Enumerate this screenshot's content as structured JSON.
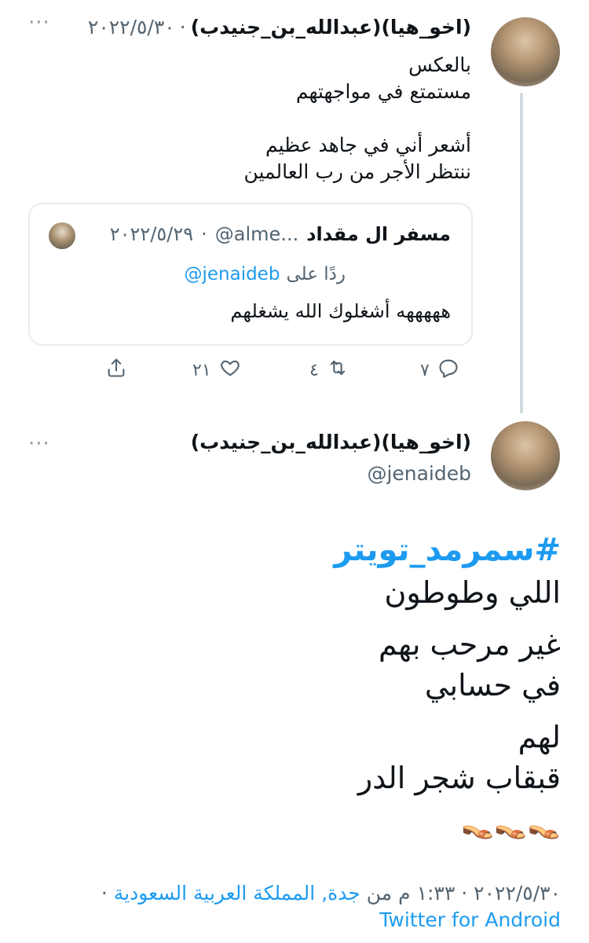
{
  "reply_tweet": {
    "display_name": "(اخو_هيا)(عبدالله_بن_جنيدب)",
    "date": "٢٠٢٢/٥/٣٠",
    "separator": "·",
    "text_lines": [
      "بالعكس",
      "مستمتع في مواجهتهم",
      "",
      "أشعر أني في جاهد عظيم",
      "ننتظر الأجر من رب العالمين"
    ],
    "more_icon": "more-horizontal-icon",
    "quote": {
      "display_name": "مسفر ال مقداد",
      "handle": "@alme...",
      "date": "٢٠٢٢/٥/٢٩",
      "separator": "·",
      "replying_to_label": "ردًا على",
      "replying_to_handle": "@jenaideb",
      "text": "هههههه أشغلوك الله يشغلهم"
    },
    "actions": {
      "reply_count": "٧",
      "retweet_count": "٤",
      "like_count": "٢١"
    }
  },
  "main_tweet": {
    "display_name": "(اخو_هيا)(عبدالله_بن_جنيدب)",
    "handle": "@jenaideb",
    "hashtag": "#سمرمد_تويتر",
    "paragraphs": [
      [
        "اللي وطوطون"
      ],
      [
        "غير مرحب بهم",
        "في حسابي"
      ],
      [
        "لهم",
        "قبقاب شجر الدر"
      ]
    ],
    "emoji": "👡👡👡",
    "time": "١:٣٣ م",
    "date": "٢٠٢٢/٥/٣٠",
    "separator": "·",
    "from_label": "من",
    "location": "جدة, المملكة العربية السعودية",
    "source": "Twitter for Android"
  },
  "colors": {
    "accent": "#1d9bf0",
    "text": "#0f1419",
    "secondary": "#536471",
    "border": "#e6ecf0"
  }
}
